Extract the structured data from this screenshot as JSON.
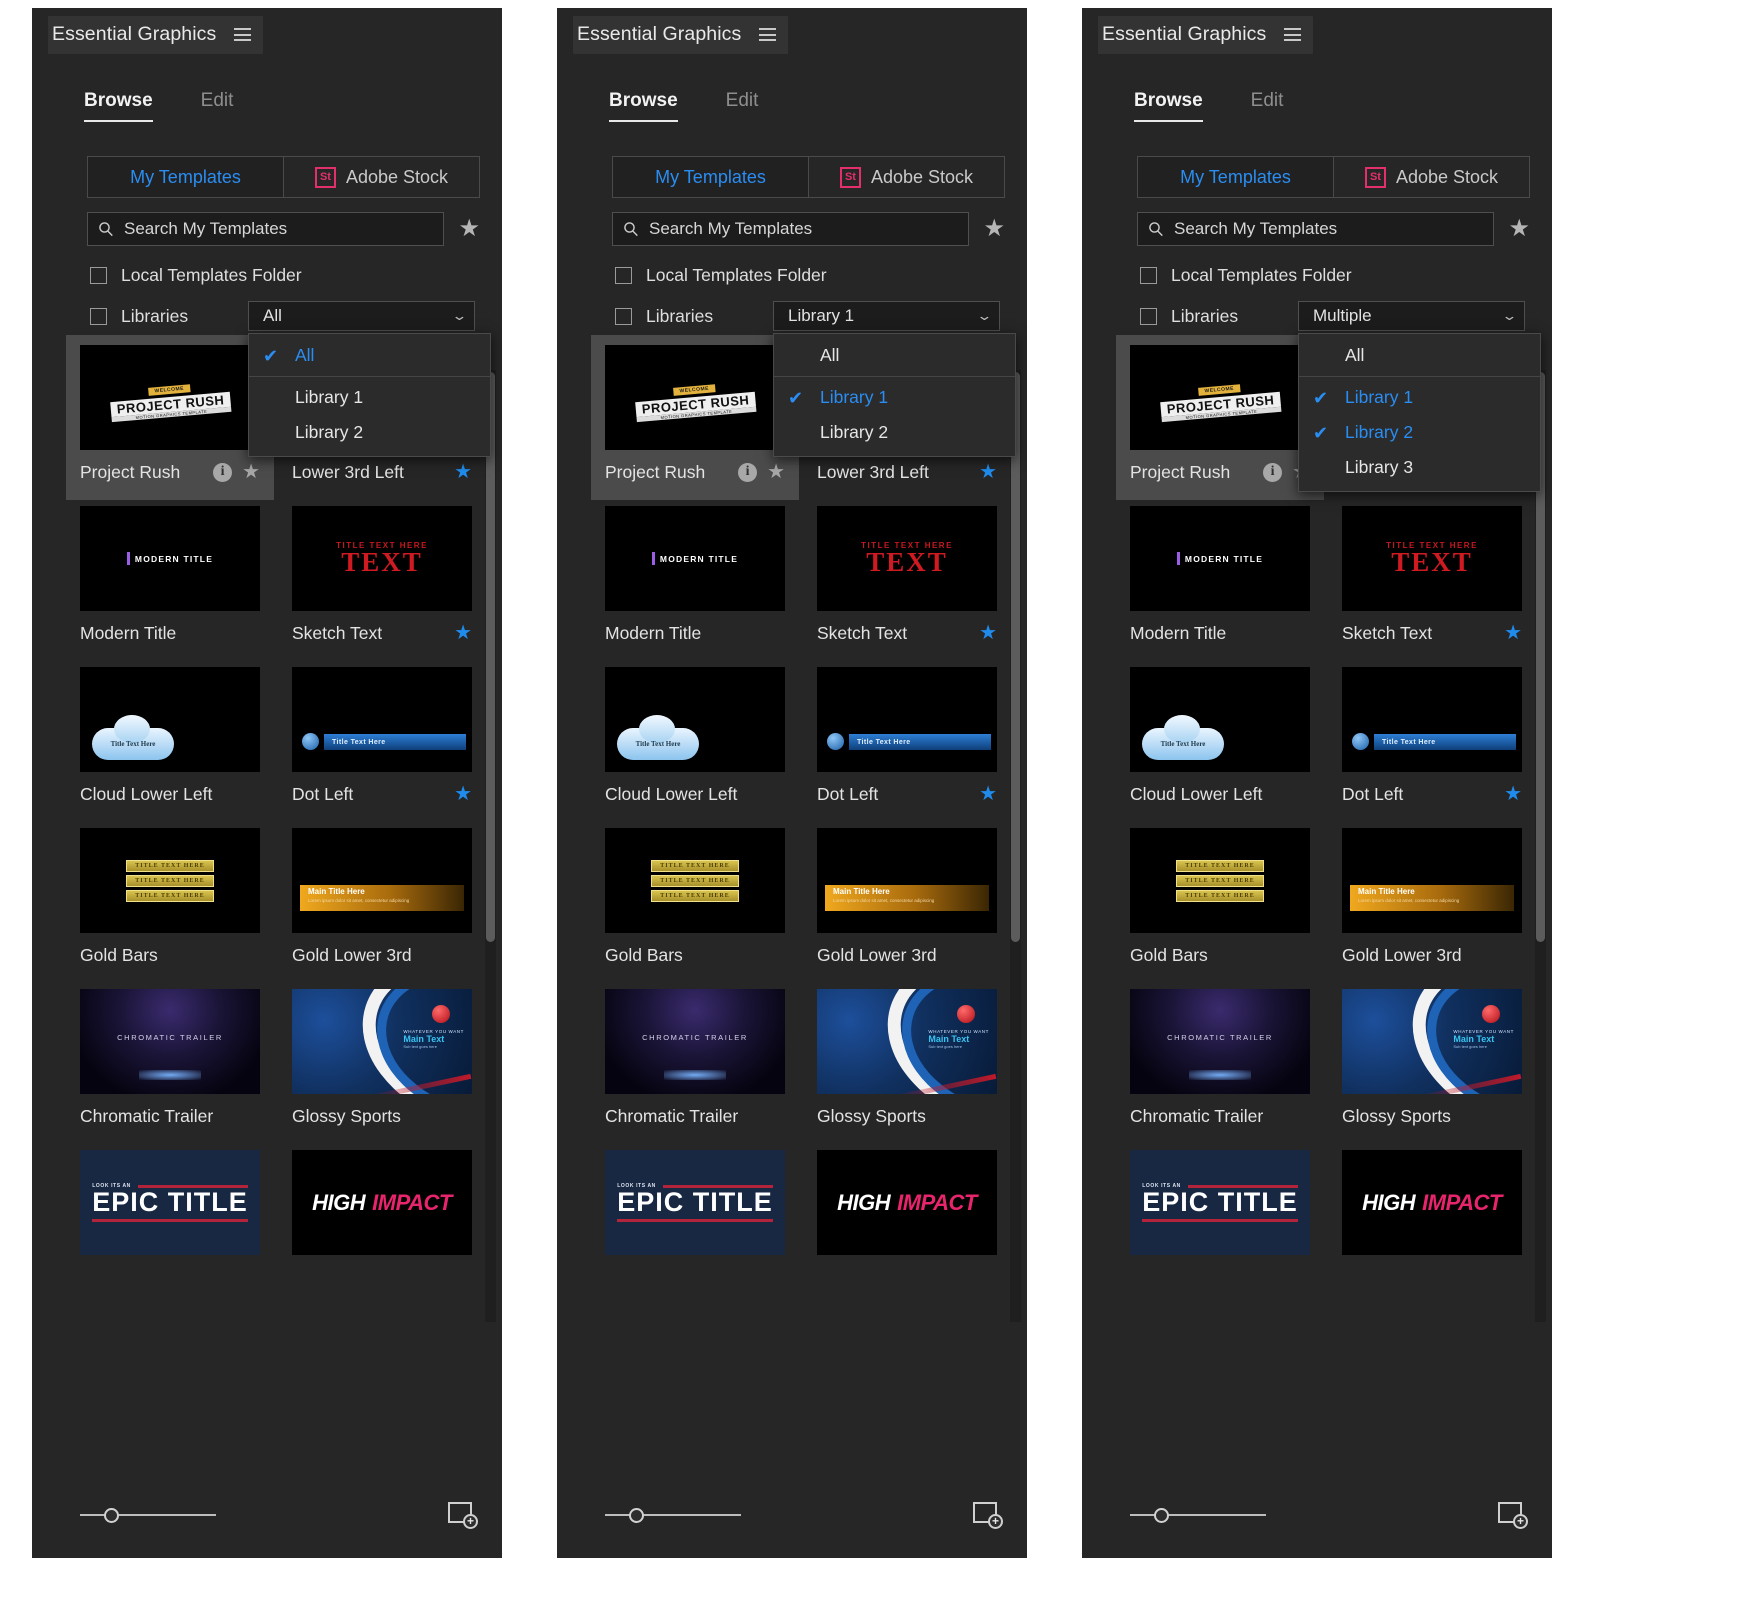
{
  "panel": {
    "title": "Essential Graphics",
    "menu_icon": "hamburger-icon",
    "tabs": [
      {
        "label": "Browse",
        "active": true
      },
      {
        "label": "Edit",
        "active": false
      }
    ],
    "source_tabs": [
      {
        "label": "My Templates",
        "selected": true
      },
      {
        "label": "Adobe Stock",
        "selected": false,
        "badge": "St"
      }
    ],
    "search": {
      "placeholder": "Search My Templates",
      "value": "Search My Templates"
    },
    "favorites_icon": "star-icon",
    "filters": [
      {
        "label": "Local Templates Folder",
        "checked": false
      },
      {
        "label": "Libraries",
        "checked": false
      }
    ],
    "footer": {
      "zoom_slider": "thumbnail-size-slider",
      "new_item": "new-layer-button"
    }
  },
  "dropdowns": [
    {
      "value": "All",
      "items": [
        {
          "label": "All",
          "checked": true
        },
        {
          "label": "Library 1",
          "checked": false
        },
        {
          "label": "Library 2",
          "checked": false
        }
      ]
    },
    {
      "value": "Library 1",
      "items": [
        {
          "label": "All",
          "checked": false
        },
        {
          "label": "Library 1",
          "checked": true
        },
        {
          "label": "Library 2",
          "checked": false
        }
      ]
    },
    {
      "value": "Multiple",
      "items": [
        {
          "label": "All",
          "checked": false
        },
        {
          "label": "Library 1",
          "checked": true
        },
        {
          "label": "Library 2",
          "checked": true
        },
        {
          "label": "Library 3",
          "checked": false
        }
      ]
    }
  ],
  "templates": [
    {
      "name": "Project Rush",
      "art": "rush",
      "selected": true,
      "info": true,
      "fav": false
    },
    {
      "name": "Lower 3rd Left",
      "art": "dark",
      "selected": false,
      "info": false,
      "fav": true
    },
    {
      "name": "Modern Title",
      "art": "modern",
      "selected": false,
      "info": false,
      "fav": false
    },
    {
      "name": "Sketch Text",
      "art": "sketch",
      "selected": false,
      "info": false,
      "fav": true
    },
    {
      "name": "Cloud Lower Left",
      "art": "cloud",
      "selected": false,
      "info": false,
      "fav": false
    },
    {
      "name": "Dot Left",
      "art": "dot",
      "selected": false,
      "info": false,
      "fav": true
    },
    {
      "name": "Gold Bars",
      "art": "gold",
      "selected": false,
      "info": false,
      "fav": false
    },
    {
      "name": "Gold Lower 3rd",
      "art": "gold3",
      "selected": false,
      "info": false,
      "fav": false
    },
    {
      "name": "Chromatic Trailer",
      "art": "chrom",
      "selected": false,
      "info": false,
      "fav": false
    },
    {
      "name": "Glossy Sports",
      "art": "glossy",
      "selected": false,
      "info": false,
      "fav": false
    },
    {
      "name": "",
      "art": "epic",
      "selected": false,
      "info": false,
      "fav": false
    },
    {
      "name": "",
      "art": "impact",
      "selected": false,
      "info": false,
      "fav": false
    }
  ],
  "thumb_text": {
    "rush_small": "WELCOME",
    "rush_main": "PROJECT RUSH",
    "rush_sub": "MOTION GRAPHICS TEMPLATE",
    "modern": "MODERN TITLE",
    "sketch_small": "TITLE TEXT HERE",
    "sketch_big": "TEXT",
    "cloud": "Title Text Here",
    "dot": "Title Text Here",
    "gold_bar": "TITLE TEXT HERE",
    "gold3_title": "Main Title Here",
    "gold3_sub": "Lorem ipsum dolor sit amet, consectetur adipiscing",
    "chromatic": "CHROMATIC TRAILER",
    "glossy_small": "WHATEVER YOU WANT",
    "glossy_main": "Main Text",
    "glossy_sub": "Sub text goes here",
    "epic_pre": "LOOK ITS AN",
    "epic_main": "EPIC TITLE",
    "impact_a": "HIGH",
    "impact_b": "IMPACT"
  },
  "colors": {
    "panel_bg": "#262626",
    "accent_blue": "#2a8df2",
    "stock_pink": "#e4306a",
    "selected_row": "#4b4b4b"
  }
}
